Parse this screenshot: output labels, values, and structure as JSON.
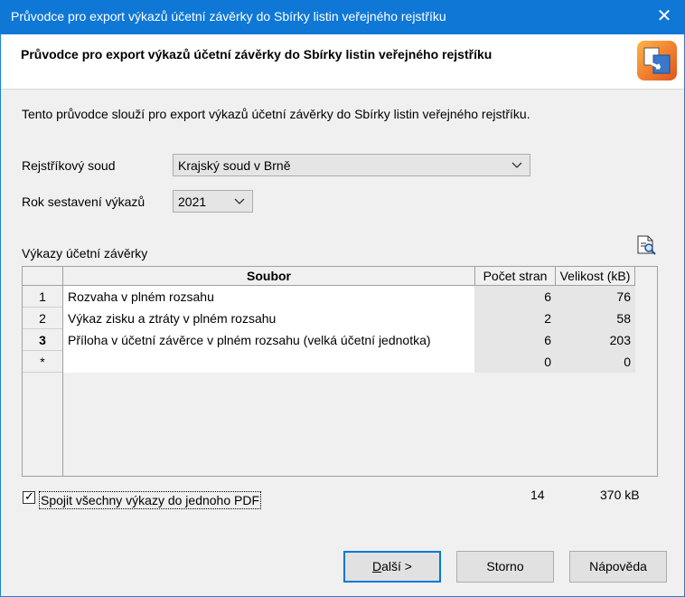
{
  "window": {
    "title": "Průvodce pro export výkazů účetní závěrky do Sbírky listin veřejného rejstříku",
    "close_glyph": "✕"
  },
  "header": {
    "title": "Průvodce pro export výkazů účetní závěrky do Sbírky listin veřejného rejstříku",
    "icon": "export-wizard-icon"
  },
  "intro": "Tento průvodce slouží pro export výkazů účetní závěrky do Sbírky listin veřejného rejstříku.",
  "form": {
    "court_label": "Rejstříkový soud",
    "court_value": "Krajský soud v Brně",
    "year_label": "Rok sestavení výkazů",
    "year_value": "2021"
  },
  "grid": {
    "caption": "Výkazy účetní závěrky",
    "columns": [
      "Soubor",
      "Počet stran",
      "Velikost (kB)"
    ],
    "rows": [
      {
        "num": "1",
        "file": "Rozvaha v plném rozsahu",
        "pages": "6",
        "size": "76"
      },
      {
        "num": "2",
        "file": "Výkaz zisku a ztráty v plném rozsahu",
        "pages": "2",
        "size": "58"
      },
      {
        "num": "3",
        "file": "Příloha v účetní závěrce v plném rozsahu (velká účetní jednotka)",
        "pages": "6",
        "size": "203"
      },
      {
        "num": "*",
        "file": "",
        "pages": "0",
        "size": "0"
      }
    ]
  },
  "merge": {
    "label": "Spojit všechny výkazy do jednoho PDF",
    "checked": true,
    "check_glyph": "✓"
  },
  "totals": {
    "pages": "14",
    "size": "370 kB"
  },
  "buttons": {
    "next_mnemonic": "D",
    "next_rest": "alší >",
    "cancel": "Storno",
    "help": "Nápověda"
  }
}
